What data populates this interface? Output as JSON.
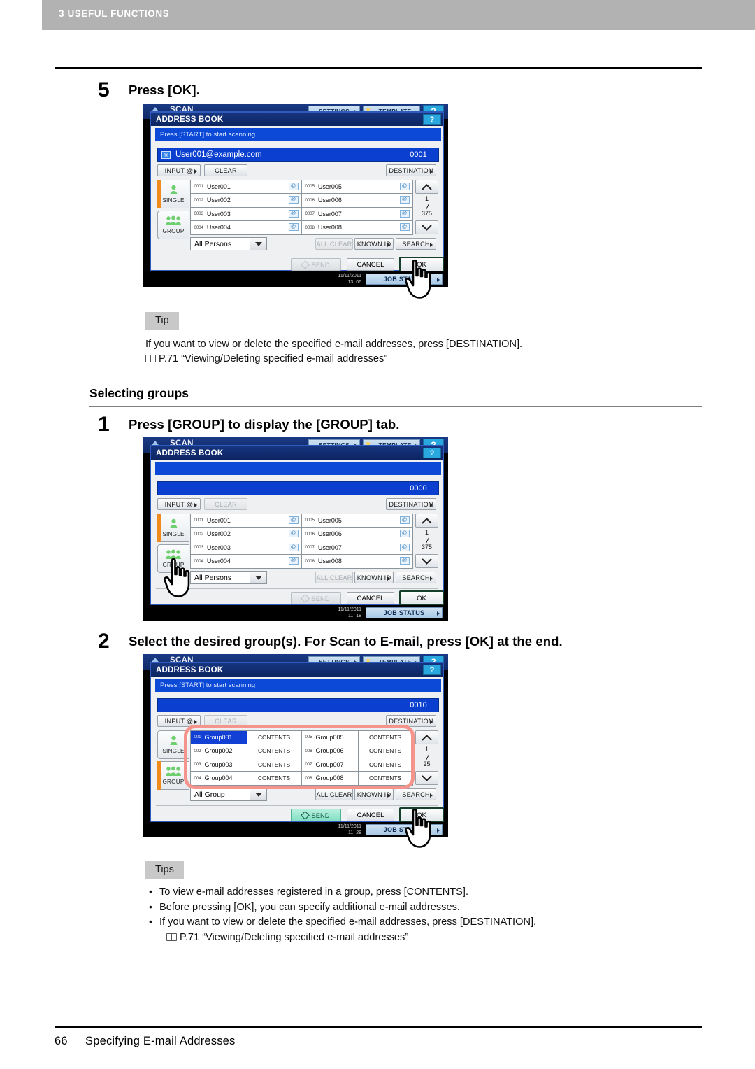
{
  "running_head": {
    "label": "3 USEFUL FUNCTIONS"
  },
  "footer": {
    "page_number": "66",
    "title": "Specifying E-mail Addresses"
  },
  "steps": [
    {
      "number": "5",
      "text": "Press [OK]."
    },
    {
      "number": "1",
      "text": "Press [GROUP] to display the [GROUP] tab."
    },
    {
      "number": "2",
      "text": "Select the desired group(s). For Scan to E-mail, press [OK] at the end."
    }
  ],
  "section_heading": "Selecting groups",
  "tip_block": {
    "label": "Tip",
    "line1": "If you want to view or delete the specified e-mail addresses, press [DESTINATION].",
    "reference": "P.71 “Viewing/Deleting specified e-mail addresses”"
  },
  "tips_block": {
    "label": "Tips",
    "items": [
      "To view e-mail addresses registered in a group, press [CONTENTS].",
      "Before pressing [OK], you can specify additional e-mail addresses.",
      "If you want to view or delete the specified e-mail addresses, press [DESTINATION]."
    ],
    "reference": "P.71 “Viewing/Deleting specified e-mail addresses”"
  },
  "lcd_common": {
    "scan_title": "SCAN",
    "settings_label": "SETTINGS",
    "template_label": "TEMPLATE",
    "help_label": "?",
    "dialog_title": "ADDRESS BOOK",
    "message": "Press [START] to start scanning",
    "input_at_label": "INPUT @",
    "clear_label": "CLEAR",
    "destination_label": "DESTINATION",
    "tab_single_label": "SINGLE",
    "tab_group_label": "GROUP",
    "all_clear_label": "ALL CLEAR",
    "known_id_label": "KNOWN ID",
    "search_label": "SEARCH",
    "send_label": "SEND",
    "cancel_label": "CANCEL",
    "ok_label": "OK",
    "job_status_label": "JOB STATUS",
    "date": "11/11/2011",
    "mail_icon_label": "@",
    "accent_orange": "#f08a1c",
    "accent_blue": "#0b3fd0",
    "annotation_red": "#f4948c"
  },
  "panel_single": {
    "message": "Press [START] to start scanning",
    "address_value": "User001@example.com",
    "counter": "0001",
    "active_tab": "SINGLE",
    "filter_value": "All Persons",
    "page_current": "1",
    "page_total": "375",
    "time": "13: 06",
    "clear_enabled": true,
    "all_clear_enabled": false,
    "send_enabled": false,
    "entries": [
      {
        "index": "0001",
        "name": "User001"
      },
      {
        "index": "0005",
        "name": "User005"
      },
      {
        "index": "0002",
        "name": "User002"
      },
      {
        "index": "0006",
        "name": "User006"
      },
      {
        "index": "0003",
        "name": "User003"
      },
      {
        "index": "0007",
        "name": "User007"
      },
      {
        "index": "0004",
        "name": "User004"
      },
      {
        "index": "0008",
        "name": "User008"
      }
    ]
  },
  "panel_group_tab": {
    "message": "",
    "address_value": "",
    "counter": "0000",
    "active_tab": "SINGLE",
    "filter_value": "All Persons",
    "page_current": "1",
    "page_total": "375",
    "time": "11: 18",
    "clear_enabled": false,
    "all_clear_enabled": false,
    "send_enabled": false,
    "entries": [
      {
        "index": "0001",
        "name": "User001"
      },
      {
        "index": "0005",
        "name": "User005"
      },
      {
        "index": "0002",
        "name": "User002"
      },
      {
        "index": "0006",
        "name": "User006"
      },
      {
        "index": "0003",
        "name": "User003"
      },
      {
        "index": "0007",
        "name": "User007"
      },
      {
        "index": "0004",
        "name": "User004"
      },
      {
        "index": "0008",
        "name": "User008"
      }
    ]
  },
  "panel_groups": {
    "message": "Press [START] to start scanning",
    "address_value": "",
    "counter": "0010",
    "active_tab": "GROUP",
    "filter_value": "All Group",
    "page_current": "1",
    "page_total": "25",
    "time": "11: 28",
    "clear_enabled": false,
    "all_clear_enabled": true,
    "send_enabled": true,
    "contents_label": "CONTENTS",
    "entries": [
      {
        "index": "001",
        "name": "Group001",
        "selected": true
      },
      {
        "index": "005",
        "name": "Group005",
        "selected": false
      },
      {
        "index": "002",
        "name": "Group002",
        "selected": false
      },
      {
        "index": "006",
        "name": "Group006",
        "selected": false
      },
      {
        "index": "003",
        "name": "Group003",
        "selected": false
      },
      {
        "index": "007",
        "name": "Group007",
        "selected": false
      },
      {
        "index": "004",
        "name": "Group004",
        "selected": false
      },
      {
        "index": "008",
        "name": "Group008",
        "selected": false
      }
    ]
  }
}
